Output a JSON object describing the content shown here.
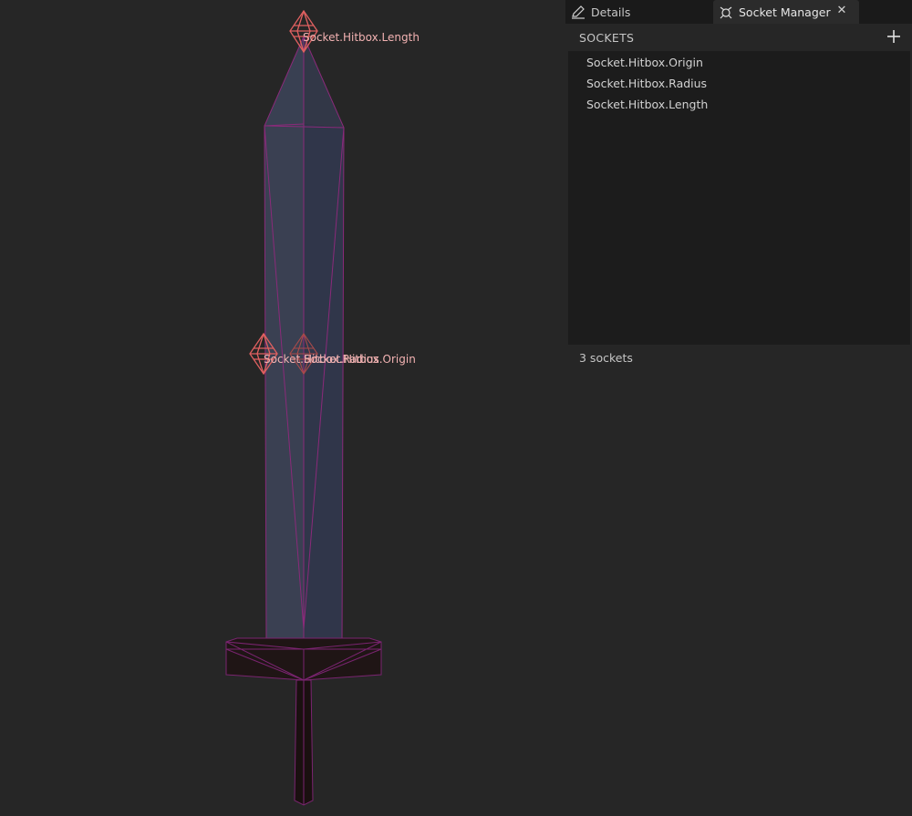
{
  "viewport": {
    "socket_labels": {
      "length": "Socket.Hitbox.Length",
      "radius": "Socket.Hitbox.Radius",
      "origin": "Socket.Hitbox.Origin"
    },
    "colors": {
      "background": "#262626",
      "blade_face_light": "#3a4052",
      "blade_face_dark": "#2e3344",
      "wireframe": "#8a2a7a",
      "guard": "#1e1414",
      "socket_marker": "#e06060",
      "socket_label": "#f2b2b2"
    }
  },
  "tabs": [
    {
      "label": "Details",
      "icon": "pencil-edit-icon",
      "active": false
    },
    {
      "label": "Socket Manager",
      "icon": "socket-manager-icon",
      "active": true,
      "close_icon": "close-icon"
    }
  ],
  "sockets_panel": {
    "title": "SOCKETS",
    "add_icon": "plus-icon",
    "items": [
      {
        "label": "Socket.Hitbox.Origin"
      },
      {
        "label": "Socket.Hitbox.Radius"
      },
      {
        "label": "Socket.Hitbox.Length"
      }
    ],
    "footer": "3 sockets"
  }
}
